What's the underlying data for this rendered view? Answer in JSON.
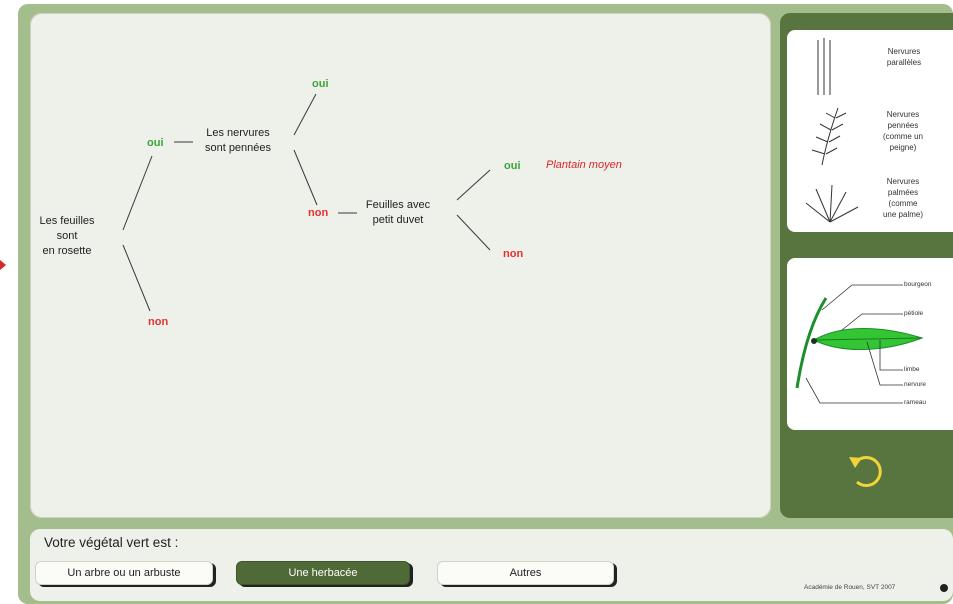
{
  "tree": {
    "root_label": "Les feuilles\nsont\nen rosette",
    "q2_label": "Les nervures\nsont pennées",
    "q3_label": "Feuilles avec\npetit duvet",
    "oui_1": "oui",
    "non_1": "non",
    "oui_2": "oui",
    "non_2": "non",
    "oui_3": "oui",
    "non_3": "non",
    "result_label": "Plantain moyen"
  },
  "legend_top": {
    "paralleles": "Nervures\nparallèles",
    "pennees": "Nervures\npennées\n(comme un\npeigne)",
    "palmees": "Nervures\npalmées\n(comme\nune palme)"
  },
  "legend_leaf": {
    "bourgeon": "bourgeon",
    "petiole": "pétiole",
    "limbe": "limbe",
    "nervure": "nervure",
    "rameau": "rameau"
  },
  "bottom": {
    "question": "Votre végétal vert est :",
    "choices": [
      "Un arbre ou un arbuste",
      "Une herbacée",
      "Autres"
    ],
    "credit": "Académie de Rouen, SVT 2007"
  },
  "colors": {
    "accent_green": "#58753f",
    "oui": "#3aa53a",
    "non": "#e53030",
    "result": "#d8262c"
  }
}
